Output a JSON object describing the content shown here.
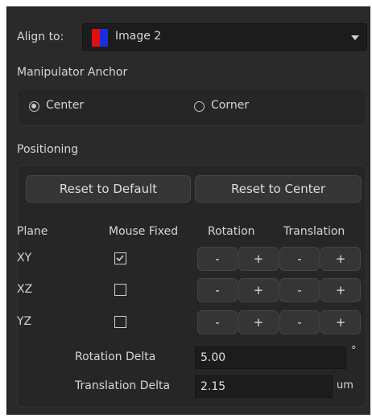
{
  "align": {
    "label": "Align to:",
    "selected": "Image 2",
    "swatch_colors": [
      "#e01010",
      "#1a2de0"
    ]
  },
  "anchor": {
    "title": "Manipulator Anchor",
    "options": [
      {
        "label": "Center",
        "selected": true
      },
      {
        "label": "Corner",
        "selected": false
      }
    ]
  },
  "positioning": {
    "title": "Positioning",
    "reset_default": "Reset to Default",
    "reset_center": "Reset to Center",
    "headers": {
      "plane": "Plane",
      "mouse_fixed": "Mouse Fixed",
      "rotation": "Rotation",
      "translation": "Translation"
    },
    "rows": [
      {
        "plane": "XY",
        "mouse_fixed": true
      },
      {
        "plane": "XZ",
        "mouse_fixed": false
      },
      {
        "plane": "YZ",
        "mouse_fixed": false
      }
    ],
    "minus": "-",
    "plus": "+",
    "rotation_delta": {
      "label": "Rotation Delta",
      "value": "5.00",
      "unit": "°"
    },
    "translation_delta": {
      "label": "Translation Delta",
      "value": "2.15",
      "unit": "um"
    }
  }
}
